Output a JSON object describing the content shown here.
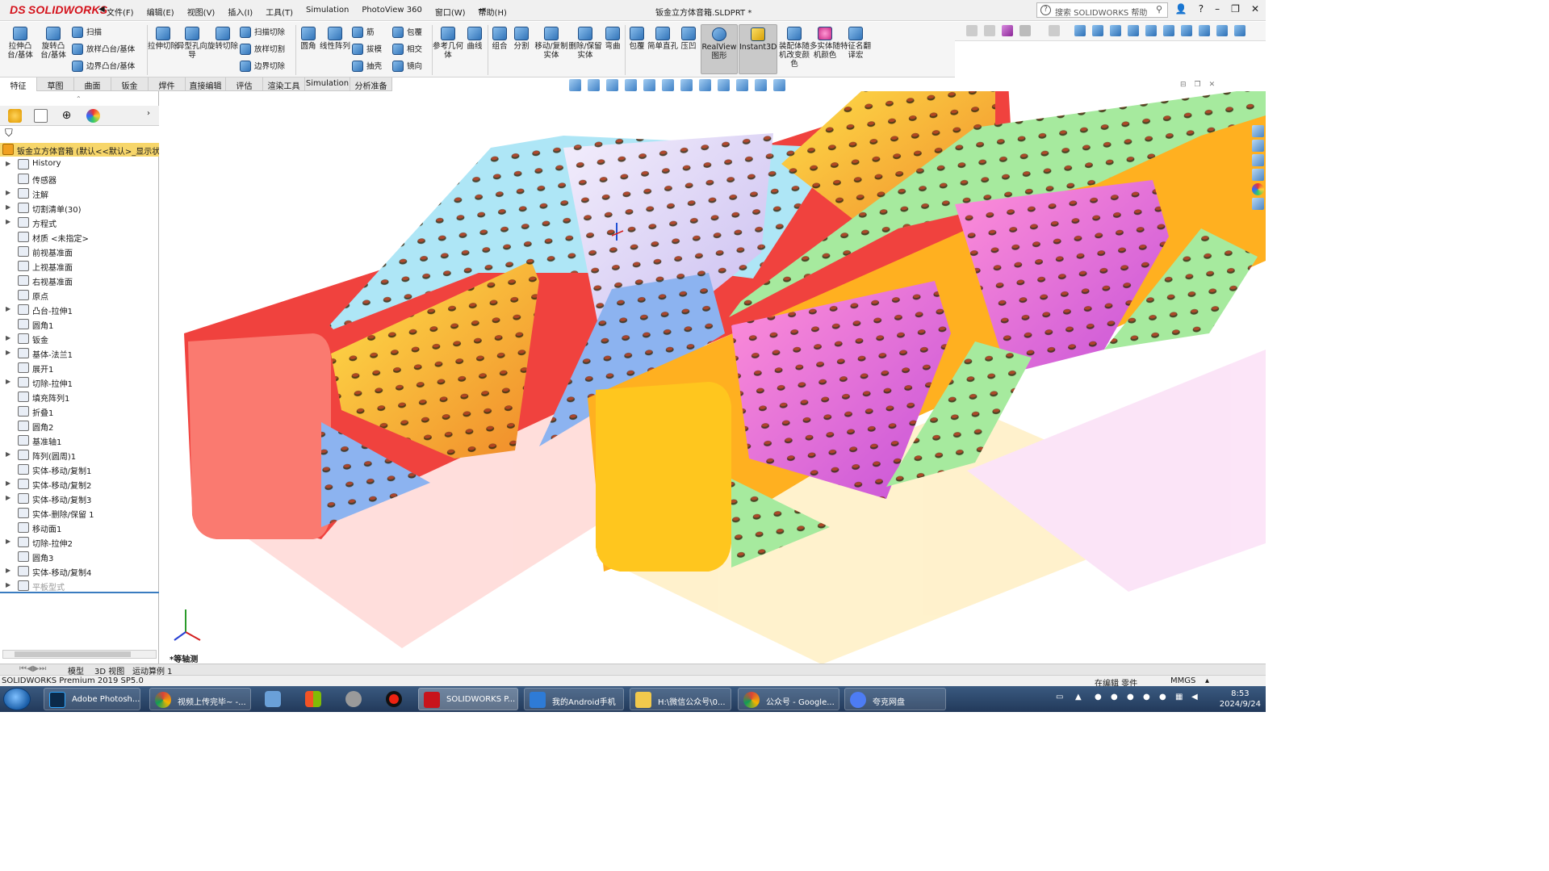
{
  "app": {
    "brand_prefix": "DS",
    "brand_solid": "SOLID",
    "brand_works": "WORKS",
    "doc_title": "钣金立方体音箱.SLDPRT *",
    "search_placeholder": "搜索 SOLIDWORKS 帮助"
  },
  "menu": [
    "文件(F)",
    "编辑(E)",
    "视图(V)",
    "插入(I)",
    "工具(T)",
    "Simulation",
    "PhotoView 360",
    "窗口(W)",
    "帮助(H)"
  ],
  "window_buttons": [
    "?",
    "–",
    "❐",
    "✕"
  ],
  "commands": {
    "extrude_boss": "拉伸凸台/基体",
    "revolve_boss": "旋转凸台/基体",
    "sweep": "扫描",
    "loft_boss": "放样凸台/基体",
    "boundary_boss": "边界凸台/基体",
    "extrude_cut": "拉伸切除",
    "hole_wizard": "异型孔向导",
    "revolve_cut": "旋转切除",
    "sweep_cut": "扫描切除",
    "loft_cut": "放样切割",
    "boundary_cut": "边界切除",
    "fillet": "圆角",
    "linear_pattern": "线性阵列",
    "rib": "筋",
    "draft": "拔模",
    "shell": "抽壳",
    "wrap": "包覆",
    "intersect": "相交",
    "mirror": "镜向",
    "ref_geometry": "参考几何体",
    "curves": "曲线",
    "combine": "组合",
    "split": "分割",
    "move_copy": "移动/复制实体",
    "delete_keep": "删除/保留实体",
    "flex": "弯曲",
    "wrap2": "包覆",
    "simple_hole": "简单直孔",
    "indent": "压凹",
    "realview": "RealView图形",
    "instant3d": "Instant3D",
    "asm_color": "装配体随机改变颜色",
    "multi_body": "多实体随机颜色",
    "feature_rename": "特征名翻译宏"
  },
  "tabs": [
    "特征",
    "草图",
    "曲面",
    "钣金",
    "焊件",
    "直接编辑",
    "评估",
    "渲染工具",
    "Simulation",
    "分析准备"
  ],
  "active_tab": "特征",
  "tree": {
    "root": "钣金立方体音箱 (默认<<默认>_显示状",
    "items": [
      {
        "label": "History",
        "exp": true
      },
      {
        "label": "传感器",
        "exp": false
      },
      {
        "label": "注解",
        "exp": true
      },
      {
        "label": "切割清单(30)",
        "exp": true
      },
      {
        "label": "方程式",
        "exp": true
      },
      {
        "label": "材质 <未指定>",
        "exp": false
      },
      {
        "label": "前视基准面",
        "exp": false
      },
      {
        "label": "上视基准面",
        "exp": false
      },
      {
        "label": "右视基准面",
        "exp": false
      },
      {
        "label": "原点",
        "exp": false
      },
      {
        "label": "凸台-拉伸1",
        "exp": true
      },
      {
        "label": "圆角1",
        "exp": false
      },
      {
        "label": "钣金",
        "exp": true
      },
      {
        "label": "基体-法兰1",
        "exp": true
      },
      {
        "label": "展开1",
        "exp": false
      },
      {
        "label": "切除-拉伸1",
        "exp": true
      },
      {
        "label": "填充阵列1",
        "exp": false
      },
      {
        "label": "折叠1",
        "exp": false
      },
      {
        "label": "圆角2",
        "exp": false
      },
      {
        "label": "基准轴1",
        "exp": false
      },
      {
        "label": "阵列(圆周)1",
        "exp": true
      },
      {
        "label": "实体-移动/复制1",
        "exp": false
      },
      {
        "label": "实体-移动/复制2",
        "exp": true
      },
      {
        "label": "实体-移动/复制3",
        "exp": true
      },
      {
        "label": "实体-删除/保留 1",
        "exp": false
      },
      {
        "label": "移动面1",
        "exp": false
      },
      {
        "label": "切除-拉伸2",
        "exp": true
      },
      {
        "label": "圆角3",
        "exp": false
      },
      {
        "label": "实体-移动/复制4",
        "exp": true
      },
      {
        "label": "平板型式",
        "exp": true,
        "grey": true
      }
    ]
  },
  "viewport": {
    "view_label": "*等轴测"
  },
  "model_tabs": [
    "模型",
    "3D 视图",
    "运动算例 1"
  ],
  "status": {
    "left": "SOLIDWORKS Premium 2019 SP5.0",
    "editing": "在编辑 零件",
    "units": "MMGS"
  },
  "taskbar": {
    "apps": [
      "Adobe Photosh...",
      "视频上传完毕~ -...",
      "SOLIDWORKS P...",
      "我的Android手机",
      "H:\\微信公众号\\0...",
      "公众号 - Google...",
      "夸克网盘"
    ],
    "time": "8:53",
    "date": "2024/9/24"
  },
  "colors": {
    "brand_red": "#d4121b",
    "tree_root_highlight": "#f7d66a",
    "taskbar": "#22395a"
  }
}
